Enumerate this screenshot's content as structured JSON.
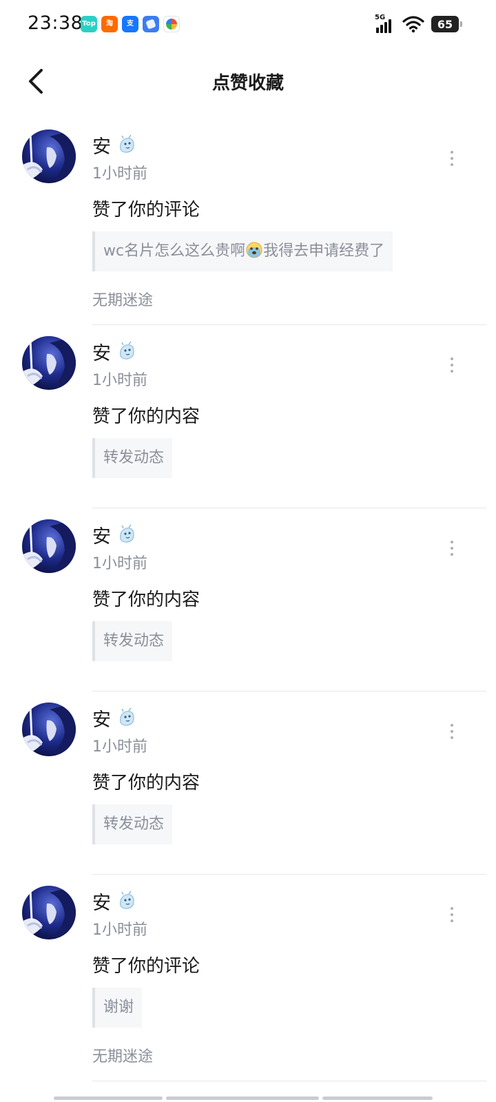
{
  "status_bar": {
    "time": "23:38",
    "network": "5G",
    "battery": "65",
    "app_icons": [
      {
        "label": "Top",
        "color": "#2ad0c4",
        "name": "top-app-icon"
      },
      {
        "label": "淘",
        "color": "#ff6a00",
        "name": "taobao-icon"
      },
      {
        "label": "支",
        "color": "#1677ff",
        "name": "alipay-icon"
      },
      {
        "label": "",
        "color": "#3d7cf0",
        "name": "blue-app-icon"
      },
      {
        "label": "",
        "color": "#ffffff",
        "name": "pinwheel-app-icon"
      }
    ]
  },
  "header": {
    "title": "点赞收藏"
  },
  "feed": {
    "items": [
      {
        "username": "安",
        "time": "1小时前",
        "action": "赞了你的评论",
        "quote_before": "wc名片怎么这么贵啊",
        "quote_emoji": "crying-face-emoji",
        "quote_after": "我得去申请经费了",
        "topic": "无期迷途"
      },
      {
        "username": "安",
        "time": "1小时前",
        "action": "赞了你的内容",
        "quote_before": "转发动态",
        "quote_emoji": "",
        "quote_after": "",
        "topic": ""
      },
      {
        "username": "安",
        "time": "1小时前",
        "action": "赞了你的内容",
        "quote_before": "转发动态",
        "quote_emoji": "",
        "quote_after": "",
        "topic": ""
      },
      {
        "username": "安",
        "time": "1小时前",
        "action": "赞了你的内容",
        "quote_before": "转发动态",
        "quote_emoji": "",
        "quote_after": "",
        "topic": ""
      },
      {
        "username": "安",
        "time": "1小时前",
        "action": "赞了你的评论",
        "quote_before": "谢谢",
        "quote_emoji": "",
        "quote_after": "",
        "topic": "无期迷途"
      }
    ]
  }
}
